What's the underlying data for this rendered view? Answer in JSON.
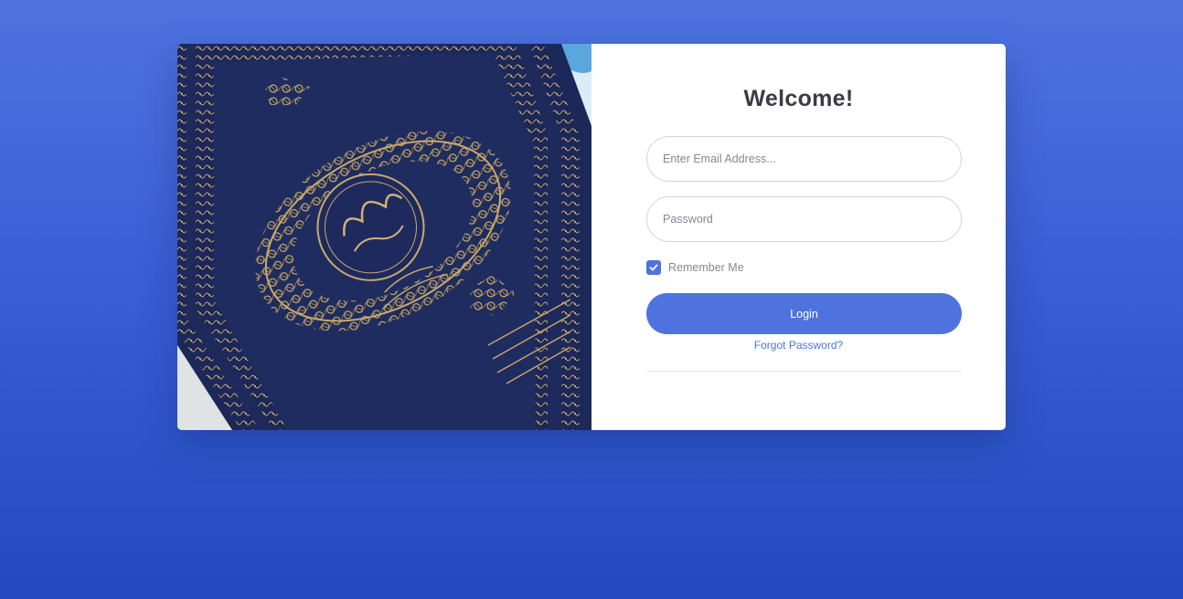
{
  "login": {
    "title": "Welcome!",
    "email_placeholder": "Enter Email Address...",
    "password_placeholder": "Password",
    "remember_label": "Remember Me",
    "remember_checked": true,
    "login_label": "Login",
    "forgot_label": "Forgot Password?"
  },
  "hero": {
    "image_subject": "ornate-book-cover"
  },
  "colors": {
    "primary": "#4e73df",
    "background_top": "#4e73df",
    "background_bottom": "#224abe",
    "title": "#3a3b45",
    "muted": "#858796",
    "book_navy": "#1e2a5a",
    "gold": "#c9a96a"
  }
}
